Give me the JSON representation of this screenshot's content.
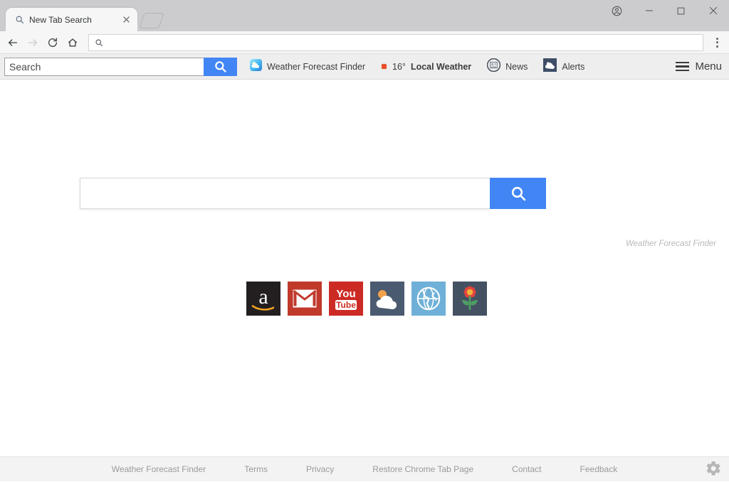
{
  "browser": {
    "tab": {
      "title": "New Tab Search",
      "favicon_icon": "search-icon",
      "close_icon": "close-icon"
    },
    "new_tab_button_icon": "new-tab-icon",
    "window_controls": {
      "profile_icon": "account-circle-icon",
      "minimize_icon": "minimize-icon",
      "maximize_icon": "maximize-icon",
      "close_icon": "close-icon"
    },
    "nav": {
      "back_icon": "back-arrow-icon",
      "forward_icon": "forward-arrow-icon",
      "reload_icon": "reload-icon",
      "home_icon": "home-icon",
      "omnibox_icon": "search-icon",
      "omnibox_value": "",
      "omnibox_placeholder": "",
      "menu_icon": "three-dot-menu-icon"
    }
  },
  "toolbar": {
    "search": {
      "value": "",
      "placeholder": "Search",
      "button_icon": "search-icon"
    },
    "items": [
      {
        "label": "Weather Forecast Finder",
        "icon": "weather-cloud-sun-icon"
      },
      {
        "label": "Local Weather",
        "temperature": "16°",
        "icon": "dot-icon"
      },
      {
        "label": "News",
        "icon": "newspaper-icon"
      },
      {
        "label": "Alerts",
        "icon": "cloud-alert-icon"
      }
    ],
    "menu": {
      "label": "Menu",
      "icon": "hamburger-menu-icon"
    }
  },
  "main": {
    "brandmark": "Weather Forecast Finder",
    "search": {
      "value": "",
      "placeholder": "",
      "button_icon": "search-icon"
    },
    "tiles": [
      {
        "name": "Amazon",
        "icon": "amazon-icon",
        "bg": "#231f20"
      },
      {
        "name": "Gmail",
        "icon": "gmail-envelope-icon",
        "bg": "#c0392b"
      },
      {
        "name": "YouTube",
        "icon": "youtube-icon",
        "bg": "#cc2b25",
        "line1": "You",
        "line2": "Tube"
      },
      {
        "name": "Weather",
        "icon": "weather-cloud-sun-icon",
        "bg": "#4a5a70"
      },
      {
        "name": "Globe",
        "icon": "globe-earth-icon",
        "bg": "#6fb0d8"
      },
      {
        "name": "Flower",
        "icon": "flower-icon",
        "bg": "#445163"
      }
    ]
  },
  "footer": {
    "links": [
      "Weather Forecast Finder",
      "Terms",
      "Privacy",
      "Restore Chrome Tab Page",
      "Contact",
      "Feedback"
    ],
    "settings_icon": "gear-icon"
  },
  "colors": {
    "accent_blue": "#4285f4",
    "titlebar_gray": "#ccccce",
    "toolbar_gray": "#eeeeee",
    "footer_gray": "#f3f3f3"
  }
}
